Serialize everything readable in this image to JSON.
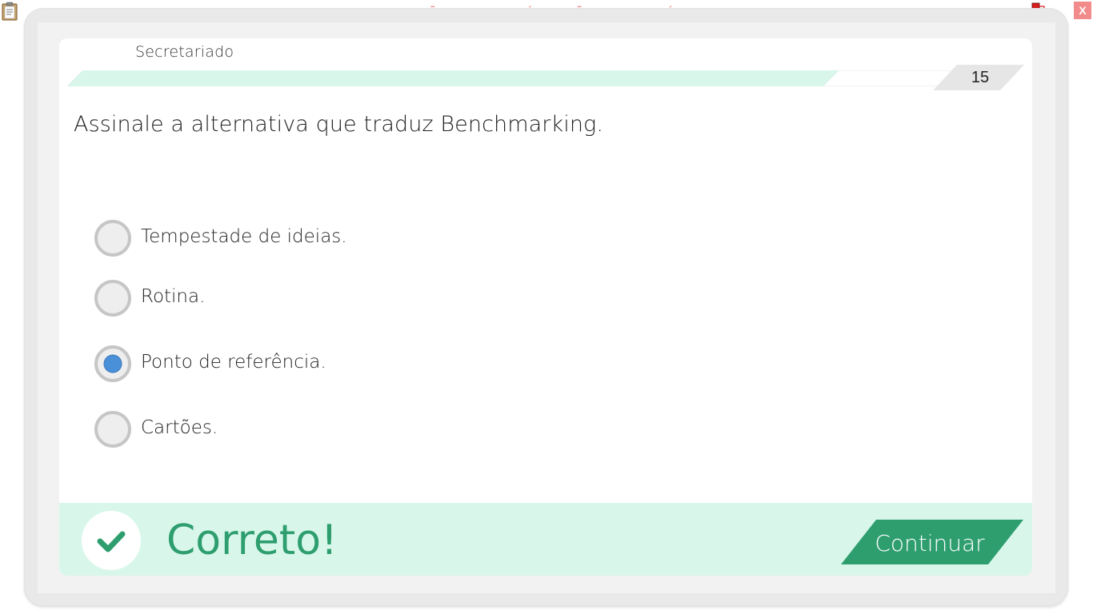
{
  "toolbar": {
    "clipboard_icon": "clipboard-icon",
    "network_icon": "network-status-icon",
    "close_label": "X"
  },
  "watermark": "VERSÃO PARA FUNCIONÁRIOS - NÃO COMERCIALIZÁVEL",
  "quiz": {
    "subject": "Secretariado",
    "question_number": "15",
    "question": "Assinale a alternativa que traduz Benchmarking.",
    "options": [
      {
        "label": "Tempestade de ideias.",
        "selected": false
      },
      {
        "label": "Rotina.",
        "selected": false
      },
      {
        "label": "Ponto de referência.",
        "selected": true
      },
      {
        "label": "Cartões.",
        "selected": false
      }
    ]
  },
  "feedback": {
    "status": "Correto!",
    "continue_label": "Continuar",
    "icon": "checkmark-icon"
  },
  "colors": {
    "accent": "#2e9e6f",
    "feedback_bg": "#d8f7ea",
    "selected_radio": "#4a90d9",
    "watermark": "#f07a7a",
    "close": "#f28b8b"
  }
}
